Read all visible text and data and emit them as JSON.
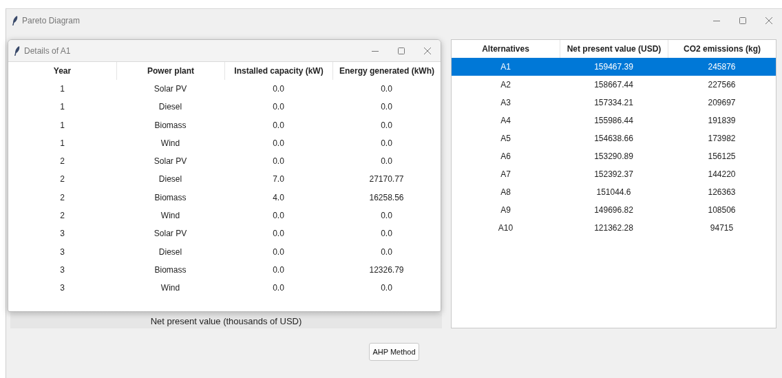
{
  "window": {
    "title": "Pareto Diagram"
  },
  "details_window": {
    "title": "Details of A1",
    "table": {
      "columns": [
        "Year",
        "Power plant",
        "Installed capacity (kW)",
        "Energy generated (kWh)"
      ],
      "rows": [
        [
          "1",
          "Solar PV",
          "0.0",
          "0.0"
        ],
        [
          "1",
          "Diesel",
          "0.0",
          "0.0"
        ],
        [
          "1",
          "Biomass",
          "0.0",
          "0.0"
        ],
        [
          "1",
          "Wind",
          "0.0",
          "0.0"
        ],
        [
          "2",
          "Solar PV",
          "0.0",
          "0.0"
        ],
        [
          "2",
          "Diesel",
          "7.0",
          "27170.77"
        ],
        [
          "2",
          "Biomass",
          "4.0",
          "16258.56"
        ],
        [
          "2",
          "Wind",
          "0.0",
          "0.0"
        ],
        [
          "3",
          "Solar PV",
          "0.0",
          "0.0"
        ],
        [
          "3",
          "Diesel",
          "0.0",
          "0.0"
        ],
        [
          "3",
          "Biomass",
          "0.0",
          "12326.79"
        ],
        [
          "3",
          "Wind",
          "0.0",
          "0.0"
        ]
      ]
    }
  },
  "chart": {
    "xlabel": "Net present value (thousands of USD)"
  },
  "alternatives_table": {
    "columns": [
      "Alternatives",
      "Net present value (USD)",
      "CO2 emissions (kg)"
    ],
    "rows": [
      {
        "cells": [
          "A1",
          "159467.39",
          "245876"
        ],
        "selected": true
      },
      {
        "cells": [
          "A2",
          "158667.44",
          "227566"
        ],
        "selected": false
      },
      {
        "cells": [
          "A3",
          "157334.21",
          "209697"
        ],
        "selected": false
      },
      {
        "cells": [
          "A4",
          "155986.44",
          "191839"
        ],
        "selected": false
      },
      {
        "cells": [
          "A5",
          "154638.66",
          "173982"
        ],
        "selected": false
      },
      {
        "cells": [
          "A6",
          "153290.89",
          "156125"
        ],
        "selected": false
      },
      {
        "cells": [
          "A7",
          "152392.37",
          "144220"
        ],
        "selected": false
      },
      {
        "cells": [
          "A8",
          "151044.6",
          "126363"
        ],
        "selected": false
      },
      {
        "cells": [
          "A9",
          "149696.82",
          "108506"
        ],
        "selected": false
      },
      {
        "cells": [
          "A10",
          "121362.28",
          "94715"
        ],
        "selected": false
      }
    ]
  },
  "buttons": [
    "AHP Method"
  ]
}
